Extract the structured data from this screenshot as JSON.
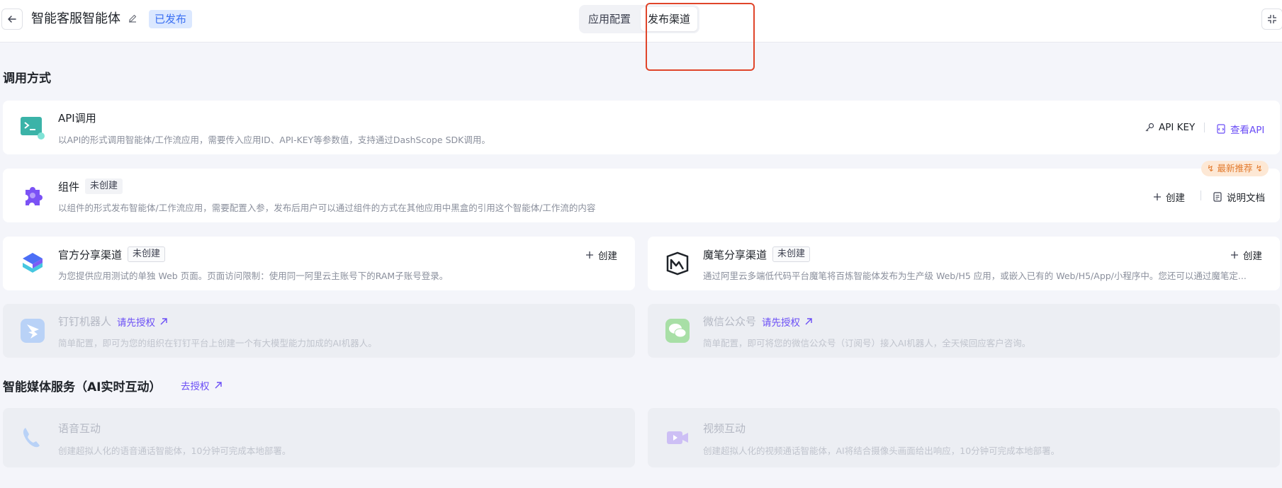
{
  "header": {
    "back_icon": "arrow-left-icon",
    "app_title": "智能客服智能体",
    "edit_icon": "pencil-icon",
    "status": "已发布",
    "tabs": [
      {
        "label": "应用配置",
        "active": false
      },
      {
        "label": "发布渠道",
        "active": true
      }
    ],
    "collapse_icon": "collapse-icon"
  },
  "sections": {
    "invoke_title": "调用方式",
    "media_title": "智能媒体服务（AI实时互动）",
    "media_link": "去授权"
  },
  "cards": {
    "api": {
      "title": "API调用",
      "desc": "以API的形式调用智能体/工作流应用，需要传入应用ID、API-KEY等参数值，支持通过DashScope SDK调用。",
      "action1": "API KEY",
      "action2": "查看API"
    },
    "component": {
      "title": "组件",
      "tag": "未创建",
      "desc": "以组件的形式发布智能体/工作流应用，需要配置入参，发布后用户可以通过组件的方式在其他应用中黑盒的引用这个智能体/工作流的内容",
      "badge": "最新推荐",
      "action1": "创建",
      "action2": "说明文档"
    },
    "official_share": {
      "title": "官方分享渠道",
      "tag": "未创建",
      "desc": "为您提供应用测试的单独 Web 页面。页面访问限制：使用同一阿里云主账号下的RAM子账号登录。",
      "action": "创建"
    },
    "mobi_share": {
      "title": "魔笔分享渠道",
      "tag": "未创建",
      "desc": "通过阿里云多端低代码平台魔笔将百炼智能体发布为生产级 Web/H5 应用，或嵌入已有的 Web/H5/App/小程序中。您还可以通过魔笔定...",
      "action": "创建"
    },
    "dingtalk": {
      "title": "钉钉机器人",
      "link": "请先授权",
      "desc": "简单配置，即可为您的组织在钉钉平台上创建一个有大模型能力加成的AI机器人。"
    },
    "wechat": {
      "title": "微信公众号",
      "link": "请先授权",
      "desc": "简单配置，即可将您的微信公众号（订阅号）接入AI机器人，全天候回应客户咨询。"
    },
    "voice": {
      "title": "语音互动",
      "desc": "创建超拟人化的语音通话智能体，10分钟可完成本地部署。"
    },
    "video": {
      "title": "视频互动",
      "desc": "创建超拟人化的视频通话智能体，AI将结合摄像头画面给出响应，10分钟可完成本地部署。"
    }
  },
  "colors": {
    "accent": "#6b4ef6",
    "highlight": "#e0452a",
    "status_bg": "#dbe8ff",
    "status_fg": "#3a6ff2"
  }
}
